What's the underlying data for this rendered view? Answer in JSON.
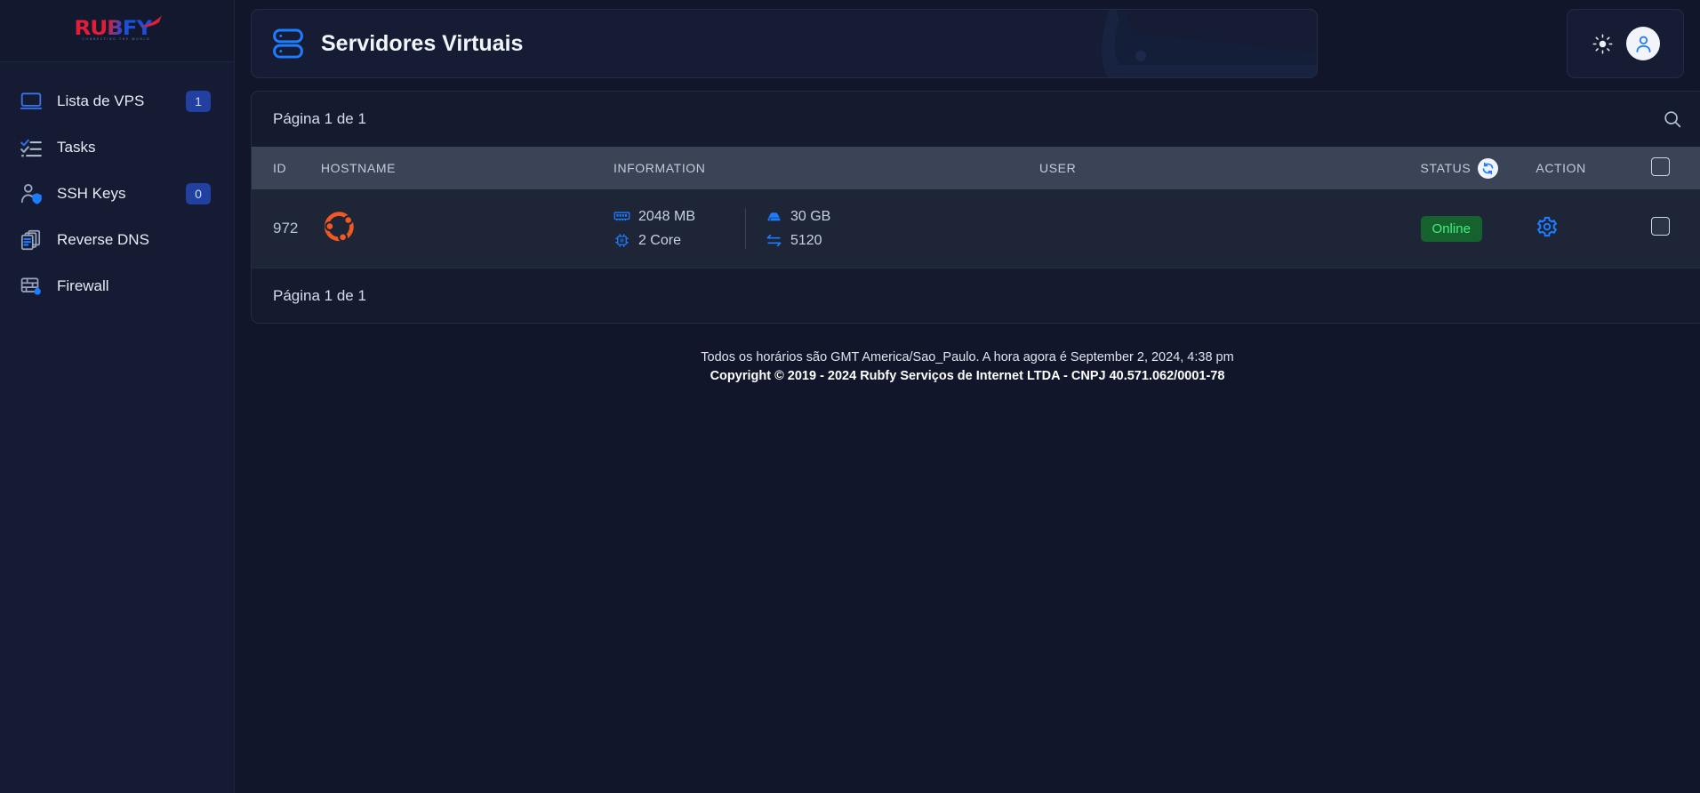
{
  "brand": {
    "logo_text": "RUBFY",
    "logo_tagline": "CONNECTING THE WORLD",
    "logo_color_red": "#e11d38",
    "logo_color_blue": "#1f4fd8"
  },
  "sidebar": {
    "items": [
      {
        "label": "Lista de VPS",
        "icon": "monitor-icon",
        "badge": "1"
      },
      {
        "label": "Tasks",
        "icon": "checklist-icon",
        "badge": ""
      },
      {
        "label": "SSH Keys",
        "icon": "user-key-icon",
        "badge": "0"
      },
      {
        "label": "Reverse DNS",
        "icon": "documents-icon",
        "badge": ""
      },
      {
        "label": "Firewall",
        "icon": "firewall-icon",
        "badge": ""
      }
    ]
  },
  "header": {
    "title": "Servidores Virtuais",
    "icon": "server-icon",
    "theme_toggle_icon": "sun-icon",
    "avatar_icon": "user-icon"
  },
  "table": {
    "pagination_top": "Página 1 de 1",
    "pagination_bottom": "Página 1 de 1",
    "search_icon": "search-icon",
    "refresh_icon": "refresh-icon",
    "columns": {
      "id": "ID",
      "hostname": "HOSTNAME",
      "information": "INFORMATION",
      "user": "USER",
      "status": "STATUS",
      "action": "ACTION"
    },
    "rows": [
      {
        "id": "972",
        "os": "ubuntu-logo",
        "hostname": "",
        "user": "",
        "ram": "2048 MB",
        "cpu": "2 Core",
        "disk": "30 GB",
        "bandwidth": "5120",
        "status": "Online",
        "status_color": "#3ff07e",
        "status_bg": "#15622f",
        "action_icon": "gear-icon"
      }
    ]
  },
  "footer": {
    "line1": "Todos os horários são GMT America/Sao_Paulo. A hora agora é September 2, 2024, 4:38 pm",
    "line2": "Copyright © 2019 - 2024 Rubfy Serviços de Internet LTDA - CNPJ 40.571.062/0001-78"
  },
  "theme": {
    "accent": "#1d7cff",
    "sidebar_bg": "#141b33",
    "page_bg": "#11162a",
    "card_bg": "#141b2f",
    "row_bg": "#1e2536",
    "thead_bg": "#3b4456"
  }
}
